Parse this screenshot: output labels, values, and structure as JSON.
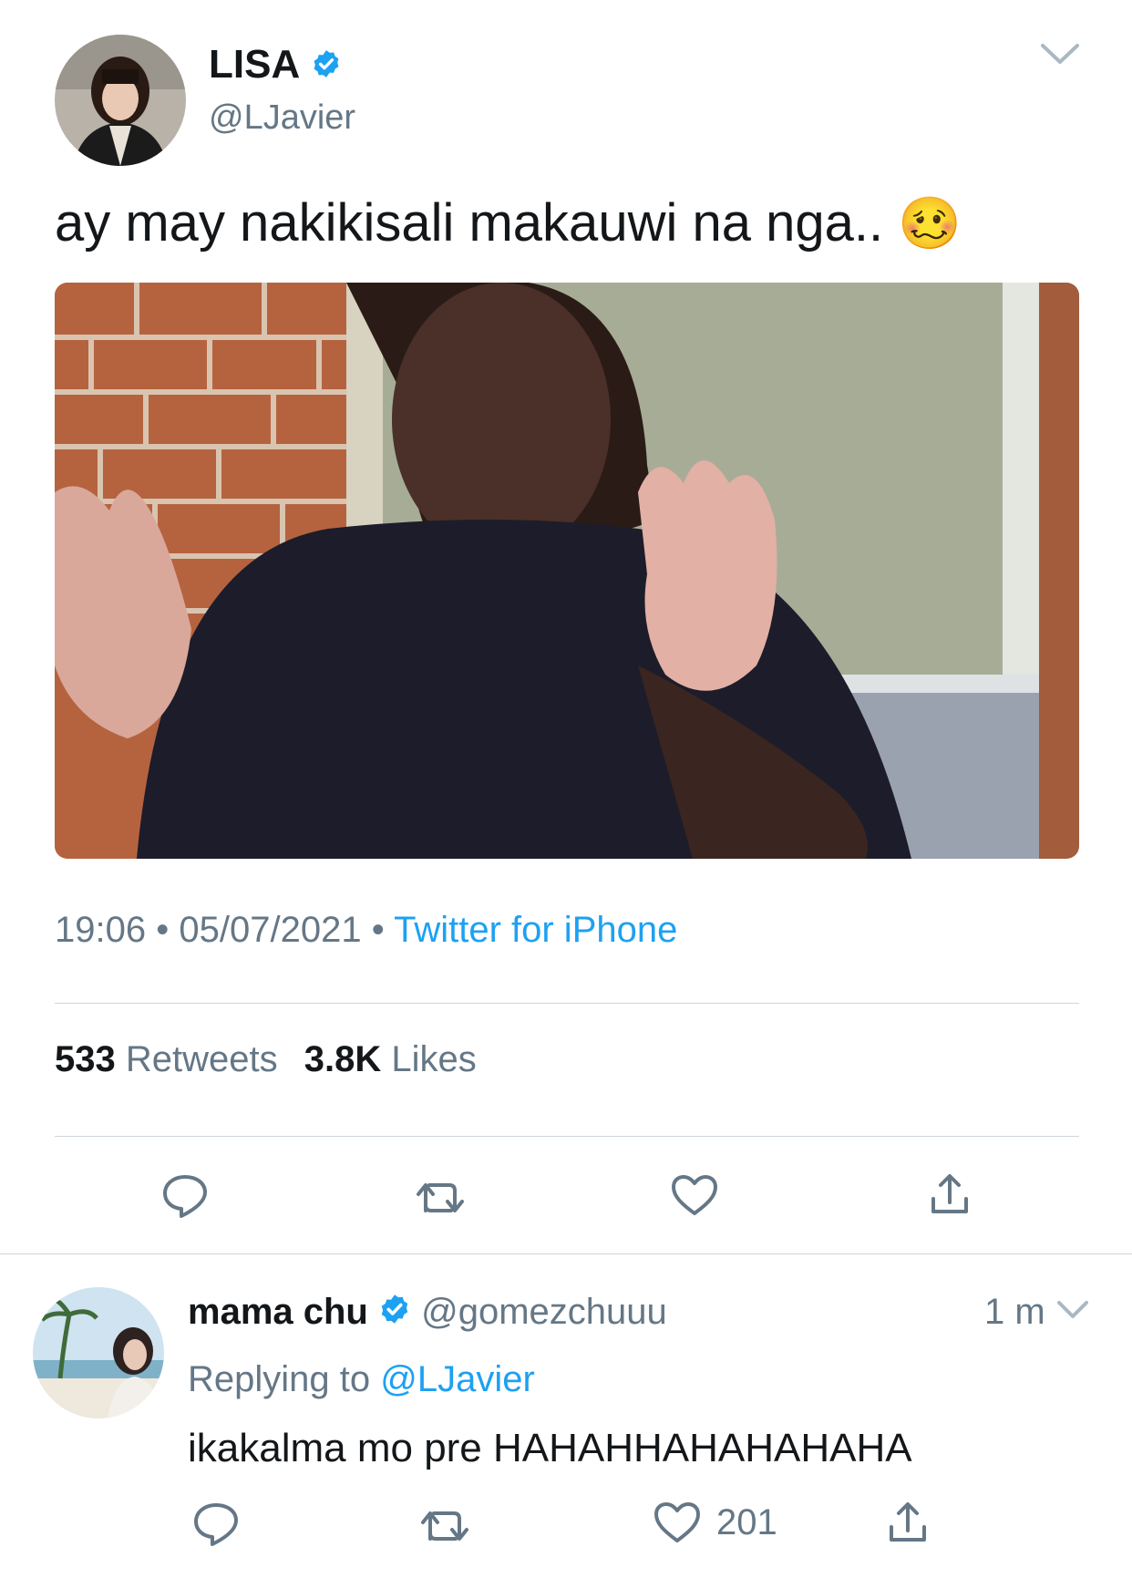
{
  "tweet": {
    "author_name": "LISA",
    "author_handle": "@LJavier",
    "text": "ay may nakikisali makauwi na nga..",
    "emoji": "🥴",
    "time": "19:06",
    "date": "05/07/2021",
    "source": "Twitter for iPhone",
    "separator": "•",
    "retweets_count": "533",
    "retweets_label": "Retweets",
    "likes_count": "3.8K",
    "likes_label": "Likes"
  },
  "reply": {
    "author_name": "mama chu",
    "author_handle": "@gomezchuuu",
    "time": "1 m",
    "replying_label": "Replying to",
    "replying_handle": "@LJavier",
    "text": "ikakalma mo pre HAHAHHAHAHAHAHA",
    "like_count": "201"
  },
  "colors": {
    "accent": "#1da1f2",
    "muted": "#657786",
    "divider": "#ccd6dd"
  },
  "icons": [
    "chevron-down-icon",
    "verified-badge-icon",
    "reply-icon",
    "retweet-icon",
    "like-icon",
    "share-icon"
  ]
}
